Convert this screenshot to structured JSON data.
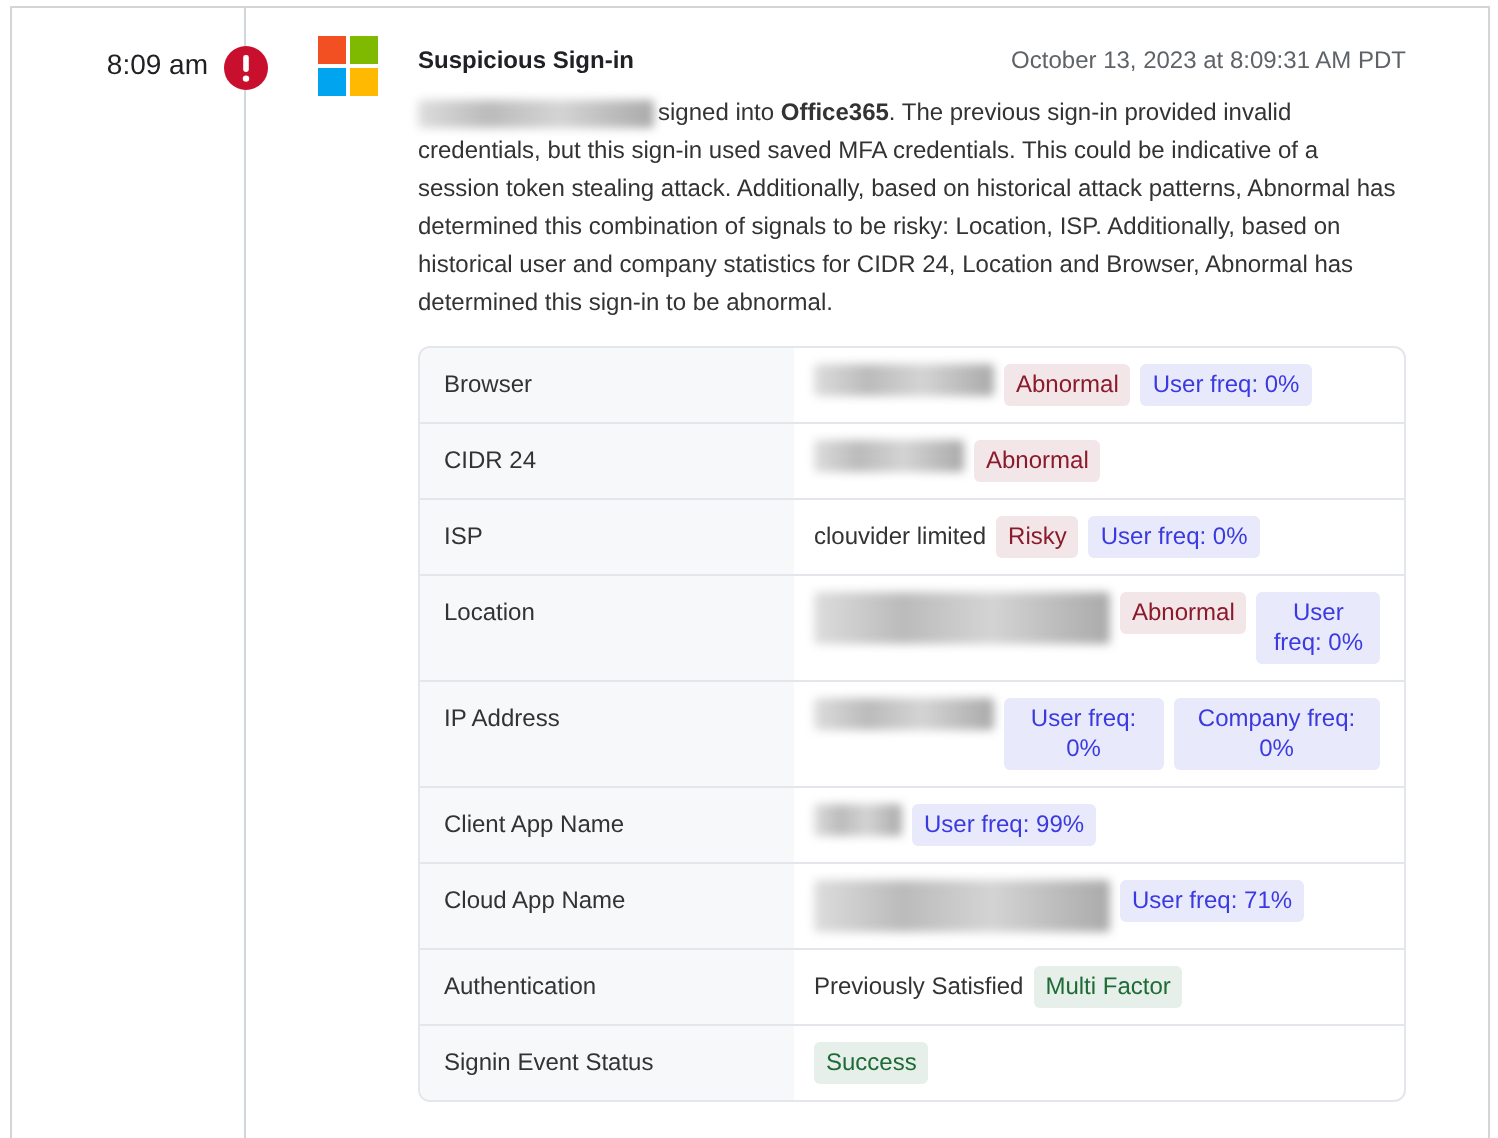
{
  "event": {
    "time": "8:09 am",
    "alert": true,
    "title": "Suspicious Sign-in",
    "timestamp": "October 13, 2023 at 8:09:31 AM PDT",
    "subject_redacted": true,
    "description": "signed into **Office365**. The previous sign-in provided invalid credentials, but this sign-in used saved MFA credentials. This could be indicative of a session token stealing attack. Additionally, based on historical attack patterns, Abnormal has determined this combination of signals to be risky: Location, ISP. Additionally, based on historical user and company statistics for CIDR 24, Location and Browser, Abnormal has determined this sign-in to be abnormal."
  },
  "details": [
    {
      "label": "Browser",
      "values": [
        {
          "kind": "redacted"
        },
        {
          "kind": "tag",
          "color": "#8b1a2b",
          "text": "Abnormal"
        },
        {
          "kind": "tag",
          "color": "#3a3ae0",
          "text": "User freq: 0%"
        }
      ]
    },
    {
      "label": "CIDR 24",
      "values": [
        {
          "kind": "redacted"
        },
        {
          "kind": "tag",
          "color": "#8b1a2b",
          "text": "Abnormal"
        }
      ]
    },
    {
      "label": "ISP",
      "values": [
        {
          "kind": "text",
          "text": "clouvider limited"
        },
        {
          "kind": "tag",
          "color": "#8b1a2b",
          "text": "Risky"
        },
        {
          "kind": "tag",
          "color": "#3a3ae0",
          "text": "User freq: 0%"
        }
      ]
    },
    {
      "label": "Location",
      "values": [
        {
          "kind": "redacted"
        },
        {
          "kind": "tag",
          "color": "#8b1a2b",
          "text": "Abnormal"
        },
        {
          "kind": "tag",
          "color": "#3a3ae0",
          "text": "User freq: 0%"
        }
      ]
    },
    {
      "label": "IP Address",
      "values": [
        {
          "kind": "redacted"
        },
        {
          "kind": "tag",
          "color": "#3a3ae0",
          "text": "User freq: 0%"
        },
        {
          "kind": "tag",
          "color": "#3a3ae0",
          "text": "Company freq: 0%"
        }
      ]
    },
    {
      "label": "Client App Name",
      "values": [
        {
          "kind": "redacted"
        },
        {
          "kind": "tag",
          "color": "#3a3ae0",
          "text": "User freq: 99%"
        }
      ]
    },
    {
      "label": "Cloud App Name",
      "values": [
        {
          "kind": "redacted"
        },
        {
          "kind": "tag",
          "color": "#3a3ae0",
          "text": "User freq: 71%"
        }
      ]
    },
    {
      "label": "Authentication",
      "values": [
        {
          "kind": "text",
          "text": "Previously Satisfied"
        },
        {
          "kind": "tag",
          "color": "#1e6b35",
          "text": "Multi Factor"
        }
      ]
    },
    {
      "label": "Signin Event Status",
      "values": [
        {
          "kind": "tag",
          "color": "#1e6b35",
          "text": "Success"
        }
      ]
    }
  ]
}
